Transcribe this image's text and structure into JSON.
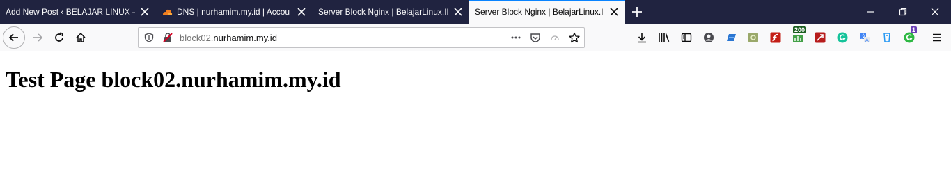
{
  "tabs": [
    {
      "title": "Add New Post ‹ BELAJAR LINUX —",
      "favicon": "wordpress-icon",
      "active": false
    },
    {
      "title": "DNS | nurhamim.my.id | Accou",
      "favicon": "cloudflare-icon",
      "active": false
    },
    {
      "title": "Server Block Nginx | BelajarLinux.ID",
      "favicon": "none",
      "active": false
    },
    {
      "title": "Server Block Nginx | BelajarLinux.ID",
      "favicon": "none",
      "active": true
    }
  ],
  "window_controls": [
    "minimize-icon",
    "restore-icon",
    "close-icon"
  ],
  "address_bar": {
    "url_prefix": "block02.",
    "url_domain": "nurhamim.my.id"
  },
  "extensions": {
    "badge_200": "200",
    "badge_1": "1"
  },
  "page": {
    "heading": "Test Page block02.nurhamim.my.id"
  },
  "colors": {
    "tabstrip": "#202340",
    "active_tab_line": "#0a84ff",
    "toolbar": "#f9f9fa"
  }
}
